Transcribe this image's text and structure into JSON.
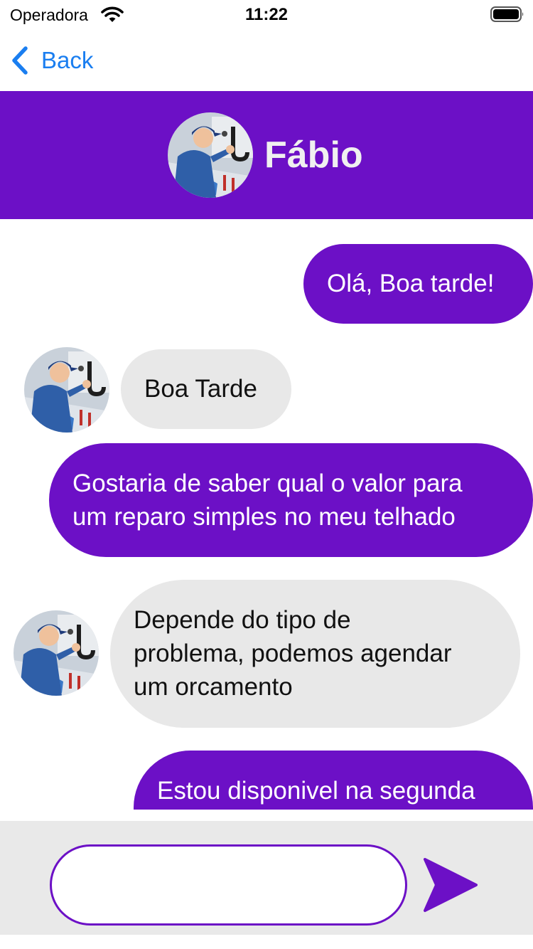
{
  "status_bar": {
    "carrier": "Operadora",
    "time": "11:22",
    "wifi_icon": "wifi-icon",
    "battery_icon": "battery-full-icon"
  },
  "nav": {
    "back_label": "Back",
    "back_icon": "chevron-left-icon",
    "tint_color": "#1a7ef0"
  },
  "chat": {
    "contact_name": "Fábio",
    "header_color": "#6c10c6",
    "avatar_icon": "contact-avatar-photo"
  },
  "messages": [
    {
      "direction": "sent",
      "text": "Olá, Boa tarde!"
    },
    {
      "direction": "received",
      "text": "Boa Tarde"
    },
    {
      "direction": "sent",
      "lines": [
        "Gostaria de saber qual o valor para",
        "um reparo simples no meu telhado"
      ]
    },
    {
      "direction": "received",
      "lines": [
        "Depende do tipo de",
        "problema, podemos agendar",
        "um orcamento"
      ]
    },
    {
      "direction": "sent",
      "text": "Estou disponivel na segunda"
    }
  ],
  "colors": {
    "sent_bubble": "#6c10c6",
    "received_bubble": "#e8e8e8",
    "input_bar_bg": "#e9e9e9"
  },
  "input": {
    "value": "",
    "placeholder": "",
    "send_icon": "send-arrow-icon"
  }
}
